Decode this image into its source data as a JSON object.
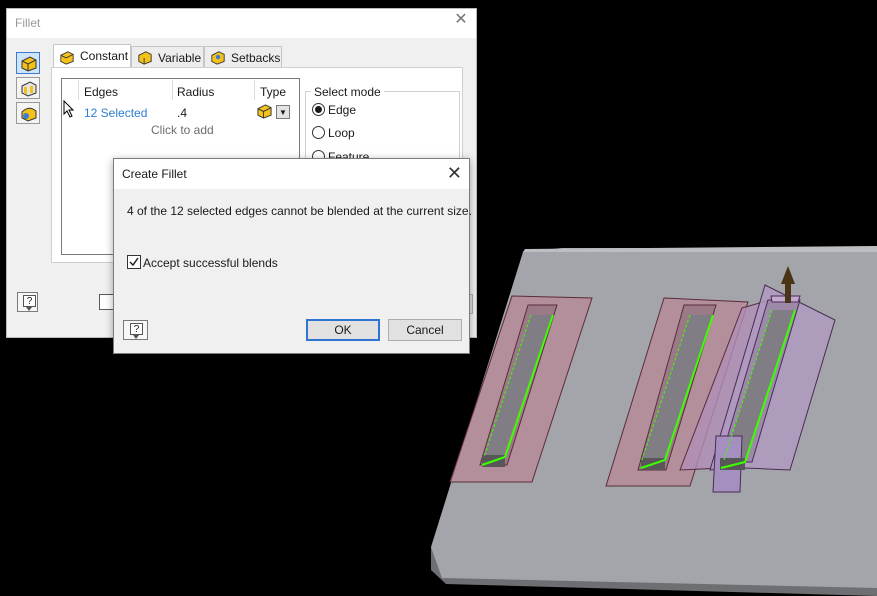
{
  "fillet_dialog": {
    "title": "Fillet",
    "tabs": [
      {
        "label": "Constant",
        "active": true
      },
      {
        "label": "Variable",
        "active": false
      },
      {
        "label": "Setbacks",
        "active": false
      }
    ],
    "table": {
      "headers": [
        "Edges",
        "Radius",
        "Type"
      ],
      "rows": [
        {
          "edges": "12 Selected",
          "radius": ".4"
        }
      ],
      "add_row_text": "Click to add"
    },
    "select_mode": {
      "legend": "Select mode",
      "options": [
        {
          "label": "Edge",
          "selected": true
        },
        {
          "label": "Loop",
          "selected": false
        },
        {
          "label": "Feature",
          "selected": false
        }
      ]
    },
    "side_icons": [
      "edge-fillet-icon",
      "face-fillet-icon",
      "full-round-fillet-icon"
    ]
  },
  "create_fillet_dialog": {
    "title": "Create Fillet",
    "message": "4 of the 12 selected edges cannot be blended at the current size.",
    "accept_checkbox": {
      "label": "Accept successful blends",
      "checked": true
    },
    "ok_label": "OK",
    "cancel_label": "Cancel"
  },
  "colors": {
    "accent": "#2f74d0",
    "link": "#2b7fcf",
    "edge_highlight": "#3cff00",
    "fillet_preview": "#b07c9a",
    "model_top": "#9c9ea4",
    "background": "#000000"
  }
}
